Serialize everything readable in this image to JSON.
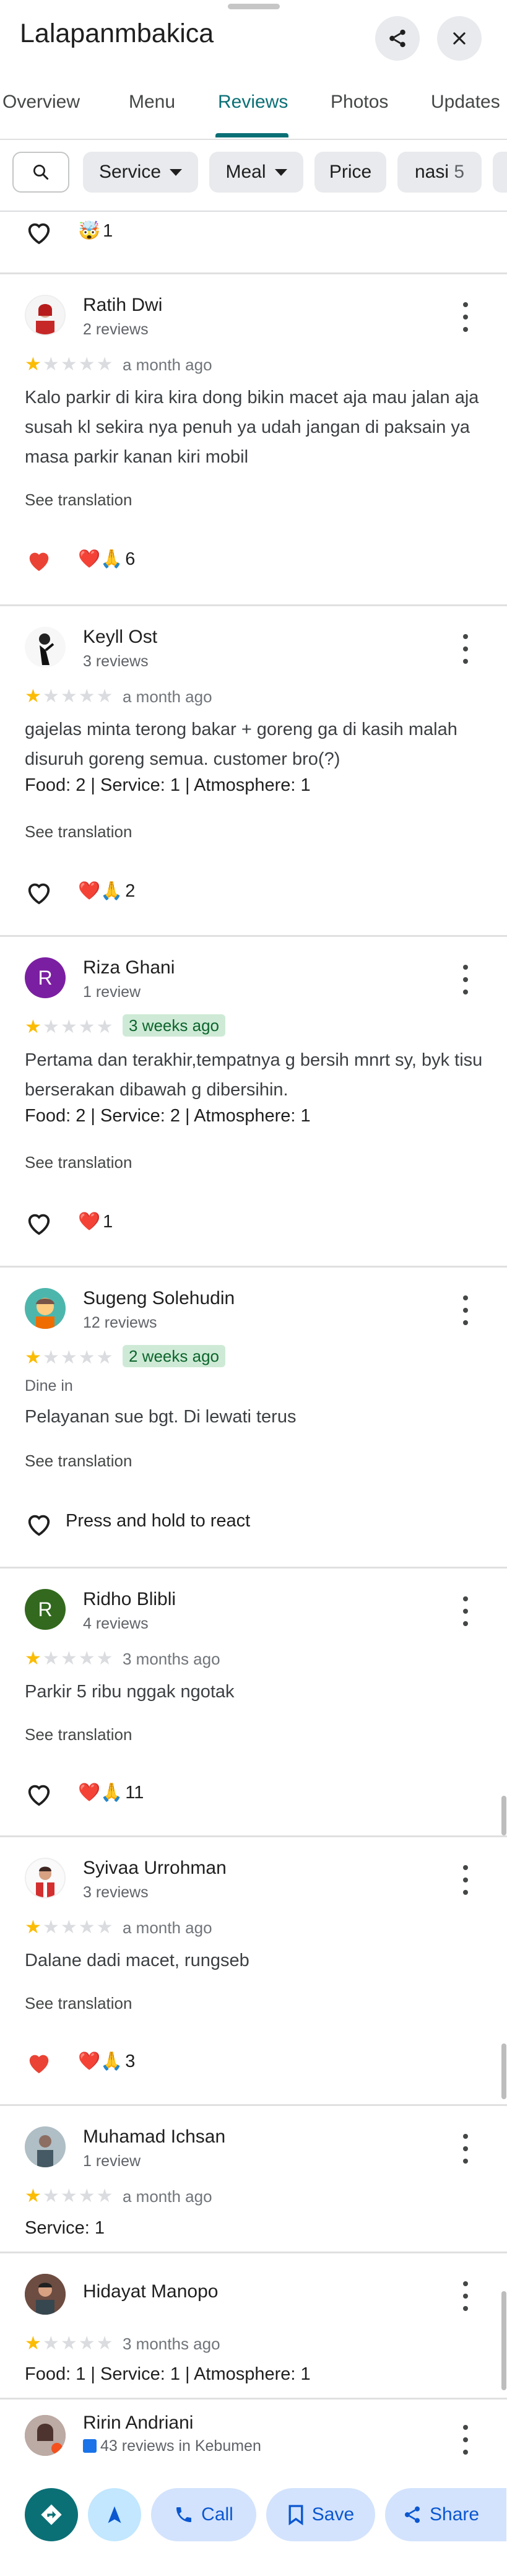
{
  "header": {
    "title": "Lalapanmbakica",
    "share_icon": "share-icon",
    "close_icon": "close-icon"
  },
  "tabs": [
    {
      "label": "Overview"
    },
    {
      "label": "Menu"
    },
    {
      "label": "Reviews",
      "active": true
    },
    {
      "label": "Photos"
    },
    {
      "label": "Updates"
    }
  ],
  "filters": {
    "search_icon": "search-icon",
    "chips": [
      {
        "label": "Service"
      },
      {
        "label": "Meal"
      },
      {
        "label": "Price"
      },
      {
        "label": "nasi",
        "count": "5"
      }
    ]
  },
  "partial_review": {
    "reaction_count": "1",
    "reaction_emoji": "🤯"
  },
  "reviews": [
    {
      "name": "Ratih Dwi",
      "sub": "2 reviews",
      "rating": 1,
      "time": "a month ago",
      "text": "Kalo parkir di kira kira dong bikin macet aja mau jalan aja susah kl sekira nya penuh ya udah jangan di paksain ya masa parkir kanan kiri mobil",
      "see_translation": "See translation",
      "liked": true,
      "reactions": "❤️🙏",
      "reaction_count": "6"
    },
    {
      "name": "Keyll Ost",
      "sub": "3 reviews",
      "rating": 1,
      "time": "a month ago",
      "text": "gajelas minta terong bakar + goreng ga di kasih malah disuruh goreng semua. customer bro(?)",
      "food_label": "Food:",
      "food": "2",
      "service_label": "Service:",
      "service": "1",
      "atmosphere_label": "Atmosphere:",
      "atmosphere": "1",
      "see_translation": "See translation",
      "liked": false,
      "reactions": "❤️🙏",
      "reaction_count": "2"
    },
    {
      "name": "Riza Ghani",
      "initial": "R",
      "sub": "1 review",
      "rating": 1,
      "time": "3 weeks ago",
      "text": "Pertama dan terakhir,tempatnya g bersih mnrt sy, byk tisu berserakan dibawah g dibersihin.",
      "food_label": "Food:",
      "food": "2",
      "service_label": "Service:",
      "service": "2",
      "atmosphere_label": "Atmosphere:",
      "atmosphere": "1",
      "see_translation": "See translation",
      "liked": false,
      "reactions": "❤️",
      "reaction_count": "1"
    },
    {
      "name": "Sugeng Solehudin",
      "sub": "12 reviews",
      "rating": 1,
      "time": "2 weeks ago",
      "dine": "Dine in",
      "text": "Pelayanan sue bgt. Di lewati terus",
      "see_translation": "See translation",
      "liked": false,
      "press_hold": "Press and hold to react"
    },
    {
      "name": "Ridho Blibli",
      "initial": "R",
      "sub": "4 reviews",
      "rating": 1,
      "time": "3 months ago",
      "text": "Parkir 5 ribu nggak ngotak",
      "see_translation": "See translation",
      "liked": false,
      "reactions": "❤️🙏",
      "reaction_count": "11"
    },
    {
      "name": "Syivaa Urrohman",
      "sub": "3 reviews",
      "rating": 1,
      "time": "a month ago",
      "text": "Dalane dadi macet, rungseb",
      "see_translation": "See translation",
      "liked": true,
      "reactions": "❤️🙏",
      "reaction_count": "3"
    },
    {
      "name": "Muhamad Ichsan",
      "sub": "1 review",
      "rating": 1,
      "time": "a month ago",
      "service_label": "Service:",
      "service": "1"
    },
    {
      "name": "Hidayat Manopo",
      "rating": 1,
      "time": "3 months ago",
      "food_label": "Food:",
      "food": "1",
      "service_label": "Service:",
      "service": "1",
      "atmosphere_label": "Atmosphere:",
      "atmosphere": "1"
    },
    {
      "name": "Ririn Andriani",
      "sub": "43 reviews in Kebumen"
    }
  ],
  "bottom_bar": {
    "directions_icon": "directions-icon",
    "start_icon": "navigation-arrow-icon",
    "call": "Call",
    "save": "Save",
    "share": "Share"
  },
  "colors": {
    "accent": "#0b7076",
    "star": "#fbbc04",
    "chip_bg": "#e8eaed",
    "badge_bg": "#ceead6",
    "button_bg": "#d3e3fd"
  }
}
